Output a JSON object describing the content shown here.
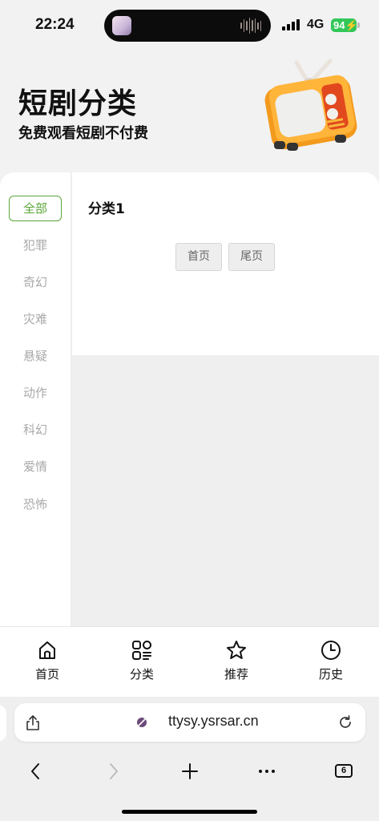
{
  "status": {
    "time": "22:24",
    "network": "4G",
    "battery": "94"
  },
  "header": {
    "title": "短剧分类",
    "subtitle": "免费观看短剧不付费"
  },
  "sidebar": {
    "items": [
      {
        "label": "全部",
        "active": true
      },
      {
        "label": "犯罪"
      },
      {
        "label": "奇幻"
      },
      {
        "label": "灾难"
      },
      {
        "label": "悬疑"
      },
      {
        "label": "动作"
      },
      {
        "label": "科幻"
      },
      {
        "label": "爱情"
      },
      {
        "label": "恐怖"
      }
    ]
  },
  "content": {
    "section_title": "分类1",
    "pagination": {
      "first_label": "首页",
      "last_label": "尾页"
    }
  },
  "tabbar": {
    "items": [
      {
        "label": "首页",
        "icon": "home-icon"
      },
      {
        "label": "分类",
        "icon": "category-grid-icon"
      },
      {
        "label": "推荐",
        "icon": "star-icon"
      },
      {
        "label": "历史",
        "icon": "clock-icon"
      }
    ]
  },
  "browser": {
    "url": "ttysy.ysrsar.cn",
    "tab_count": "6"
  },
  "colors": {
    "accent": "#5aa639",
    "inactive_text": "#a9a9a9",
    "battery": "#33c759"
  }
}
